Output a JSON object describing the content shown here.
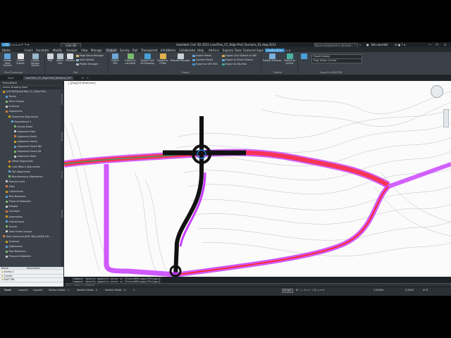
{
  "title_bar": {
    "app_menu": "C3D",
    "workspace": "Civil 3D",
    "window_title": "Autodesk Civil 3D 2021   LoneTree_CC_Align-Prof_Sections_01.dwg 2011",
    "search_placeholder": "Type a keyword or phrase",
    "user": "Ben.wardell"
  },
  "menu_tabs": [
    "Home",
    "Insert",
    "Annotate",
    "Modify",
    "Analyze",
    "View",
    "Manage",
    "Output",
    "Survey",
    "Rail",
    "Transparent",
    "InfraWorks",
    "Collaborate",
    "Help",
    "Add-ins",
    "Express Tools",
    "Featured Apps",
    "Geolocation"
  ],
  "active_menu_tab": "Output",
  "highlighted_menu_tab": "Geolocation",
  "ribbon": {
    "plot_buttons": [
      "Create View Frames",
      "Create Sheets",
      "Create Section Sheets",
      "Plot",
      "Batch Plot",
      "Preview"
    ],
    "plot_small": [
      "Page Setup Manager",
      "View Details",
      "Plotter Manager"
    ],
    "export_buttons": [
      "Export IMX",
      "Export to LandXML",
      "Export Civil 3D Drawing",
      "Export to FGDB",
      "Rebuild Manager"
    ],
    "export_small_1": [
      "Export Points",
      "Transfer Points",
      "Export to HEC RAS"
    ],
    "export_small_2": [
      "Export Civil Objects to SDF",
      "Export to Storm Sewers",
      "Export to 3ds Max"
    ],
    "publish_buttons": [
      "Publish Surfaces",
      "Publish to ArcGIS"
    ],
    "dwf_dropdowns": [
      "Export Display",
      "Page Setup: Current"
    ],
    "panel_names": [
      "Plan Production",
      "Plot",
      "Export",
      "Publish",
      "Export to DWF/PDF"
    ]
  },
  "doc_tabs": [
    "Start",
    "LoneTree_CC_Align-Prof_Sections_01*"
  ],
  "viewport_label": "[-][Top][2D Wireframe]",
  "toolspace": {
    "title": "TOOLSPACE",
    "view": "Active Drawing View",
    "tree": [
      {
        "label": "[LOCKED]LoneTree_CC_Align-Prof...",
        "indent": 1
      },
      {
        "label": "Points",
        "indent": 2
      },
      {
        "label": "Point Groups",
        "indent": 2
      },
      {
        "label": "Surfaces",
        "indent": 2
      },
      {
        "label": "Alignments",
        "indent": 2
      },
      {
        "label": "Centerline Alignments",
        "indent": 3
      },
      {
        "label": "Roundabout 1",
        "indent": 4
      },
      {
        "label": "Access Road",
        "indent": 5
      },
      {
        "label": "Alignment East",
        "indent": 5
      },
      {
        "label": "Alignment North",
        "indent": 5
      },
      {
        "label": "Alignment South",
        "indent": 5
      },
      {
        "label": "Alignment South NB",
        "indent": 5
      },
      {
        "label": "Alignment South SB",
        "indent": 5
      },
      {
        "label": "Alignment West",
        "indent": 5
      },
      {
        "label": "Offset Alignments",
        "indent": 3
      },
      {
        "label": "Curb Return Alignments",
        "indent": 3
      },
      {
        "label": "Rail Alignments",
        "indent": 3
      },
      {
        "label": "Miscellaneous Alignments",
        "indent": 3
      },
      {
        "label": "Feature Lines",
        "indent": 2
      },
      {
        "label": "Sites",
        "indent": 2
      },
      {
        "label": "Catchments",
        "indent": 2
      },
      {
        "label": "Pipe Networks",
        "indent": 2
      },
      {
        "label": "Pressure Networks",
        "indent": 2
      },
      {
        "label": "Bridges",
        "indent": 2
      },
      {
        "label": "Corridors",
        "indent": 2
      },
      {
        "label": "Assemblies",
        "indent": 2
      },
      {
        "label": "Intersections",
        "indent": 2
      },
      {
        "label": "Survey",
        "indent": 2
      },
      {
        "label": "View Frame Groups",
        "indent": 2
      },
      {
        "label": "Data Shortcuts [BIM 360://ADSK Infr...",
        "indent": 1
      },
      {
        "label": "Surfaces",
        "indent": 2
      },
      {
        "label": "Alignments",
        "indent": 2
      },
      {
        "label": "Pipe Networks",
        "indent": 2
      },
      {
        "label": "Pressure Networks",
        "indent": 2
      }
    ],
    "side_tabs": [
      "Prospector",
      "Settings",
      "Survey",
      "Toolbox"
    ],
    "table_headers": [
      "Name",
      "Description"
    ],
    "table_rows": [
      "Access 1",
      "Corrido",
      "EAST WB"
    ]
  },
  "command_line": {
    "history": [
      "Command: Specify opposite corner or [Fence/WPolygon/CPolygon]:",
      "Command: Specify opposite corner or [Fence/WPolygon/CPolygon]:"
    ],
    "prompt": "Type a command"
  },
  "layout_tabs": [
    "Model",
    "Layout1",
    "Layout2",
    "Section Sheet - 1",
    "Section Sheet - 2",
    "Section Sheet - 3"
  ],
  "status": {
    "mode": "MODEL",
    "scale": "1:50000",
    "value": "3.5000"
  },
  "colors": {
    "corridor_magenta": "#c83cff",
    "corridor_red": "#ff2a2a",
    "road_dark": "#111111",
    "ribbon_bg": "#3a4047",
    "accent": "#2d84c6"
  }
}
